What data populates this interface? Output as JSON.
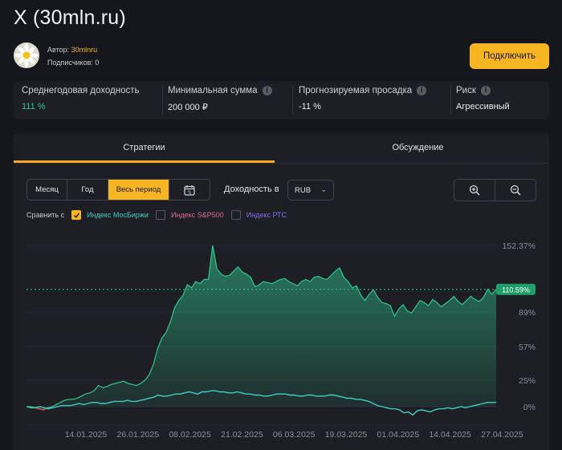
{
  "page": {
    "title": "X (30mln.ru)"
  },
  "author": {
    "label": "Автор:",
    "name": "30mlnru",
    "subscribers": "Подписчиков: 0"
  },
  "connect_label": "Подключить",
  "stats": [
    {
      "label": "Среднегодовая доходность",
      "value": "111 %",
      "info": false,
      "accent": "#2fc88f"
    },
    {
      "label": "Минимальная сумма",
      "value": "200 000 ₽",
      "info": true
    },
    {
      "label": "Прогнозируемая просадка",
      "value": "-11 %",
      "info": true
    },
    {
      "label": "Риск",
      "value": "Агрессивный",
      "info": true
    }
  ],
  "tabs": [
    {
      "label": "Стратегии",
      "active": true
    },
    {
      "label": "Обсуждение",
      "active": false
    }
  ],
  "periods": [
    {
      "label": "Месяц",
      "active": false
    },
    {
      "label": "Год",
      "active": false
    },
    {
      "label": "Весь период",
      "active": true
    }
  ],
  "calendar_icon": "calendar-icon",
  "yield_label": "Доходность в",
  "currency": "RUB",
  "compare": {
    "label": "Сравнить с",
    "items": [
      {
        "label": "Индекс МосБиржи",
        "checked": true,
        "color": "#3ecfc2"
      },
      {
        "label": "Индекс S&P500",
        "checked": false,
        "color": "#e0669b"
      },
      {
        "label": "Индекс РТС",
        "checked": false,
        "color": "#8a6cf0"
      }
    ]
  },
  "chart_data": {
    "type": "area",
    "y_ticks": [
      "152.37%",
      "89%",
      "57%",
      "25%",
      "0%"
    ],
    "ylim": [
      -10,
      160
    ],
    "x_ticks": [
      "14.01.2025",
      "26.01.2025",
      "08.02.2025",
      "21.02.2025",
      "06.03.2025",
      "19.03.2025",
      "01.04.2025",
      "14.04.2025",
      "27.04.2025"
    ],
    "current_value": 110.59,
    "current_label": "110.59%",
    "series": [
      {
        "name": "",
        "color": "#2fc88f",
        "values": [
          0,
          0,
          -1,
          -2,
          -3,
          -1,
          0,
          2,
          4,
          6,
          7,
          7,
          8,
          10,
          12,
          13,
          15,
          20,
          18,
          19,
          21,
          22,
          23,
          24,
          22,
          21,
          20,
          22,
          25,
          30,
          40,
          55,
          65,
          70,
          80,
          93,
          100,
          105,
          115,
          112,
          118,
          116,
          120,
          120,
          152.37,
          130,
          125,
          123,
          124,
          128,
          132,
          127,
          125,
          122,
          113,
          115,
          118,
          117,
          116,
          118,
          120,
          121,
          118,
          116,
          114,
          118,
          120,
          118,
          122,
          123,
          121,
          120,
          124,
          128,
          131,
          122,
          118,
          112,
          114,
          105,
          100,
          106,
          110,
          103,
          98,
          97,
          95,
          85,
          92,
          96,
          90,
          88,
          94,
          100,
          98,
          95,
          101,
          98,
          94,
          97,
          100,
          104,
          99,
          96,
          100,
          104,
          101,
          99,
          103,
          110.59,
          106,
          110.59
        ]
      },
      {
        "name": "Индекс МосБиржи",
        "color": "#3ecfc2",
        "values": [
          0,
          -1,
          -1,
          0,
          -1,
          -2,
          -1,
          0,
          1,
          1,
          1,
          2,
          3,
          2,
          3,
          4,
          4,
          3,
          3,
          4,
          5,
          5,
          5,
          6,
          5,
          5,
          6,
          7,
          8,
          9,
          11,
          10,
          10,
          11,
          12,
          12,
          13,
          14,
          13,
          12,
          14,
          14,
          15,
          15,
          14,
          14,
          13,
          13,
          14,
          13,
          12,
          12,
          11,
          11,
          10,
          10,
          11,
          12,
          12,
          12,
          11,
          11,
          10,
          10,
          11,
          11,
          10,
          10,
          10,
          11,
          11,
          10,
          9,
          8,
          8,
          7,
          7,
          6,
          5,
          3,
          1,
          0,
          -1,
          -2,
          -2,
          -3,
          -6,
          -5,
          -8,
          -4,
          -3,
          -4,
          -5,
          -3,
          -2,
          -2,
          -1,
          -2,
          -1,
          0,
          -1,
          0,
          1,
          2,
          3,
          4,
          4,
          4
        ]
      }
    ]
  }
}
